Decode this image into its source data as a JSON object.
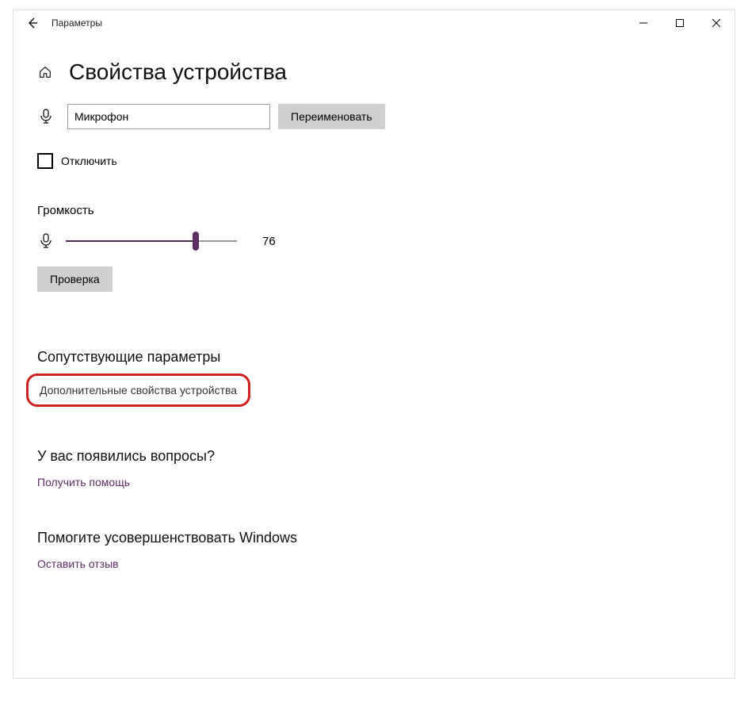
{
  "window": {
    "title": "Параметры"
  },
  "page": {
    "title": "Свойства устройства"
  },
  "device": {
    "name": "Микрофон",
    "rename_label": "Переименовать",
    "disable_label": "Отключить"
  },
  "volume": {
    "heading": "Громкость",
    "value": 76,
    "test_label": "Проверка"
  },
  "related": {
    "heading": "Сопутствующие параметры",
    "additional_props": "Дополнительные свойства устройства"
  },
  "questions": {
    "heading": "У вас появились вопросы?",
    "help_link": "Получить помощь"
  },
  "feedback": {
    "heading": "Помогите усовершенствовать Windows",
    "link": "Оставить отзыв"
  },
  "colors": {
    "accent": "#5b2d62",
    "highlight": "#d02020"
  }
}
